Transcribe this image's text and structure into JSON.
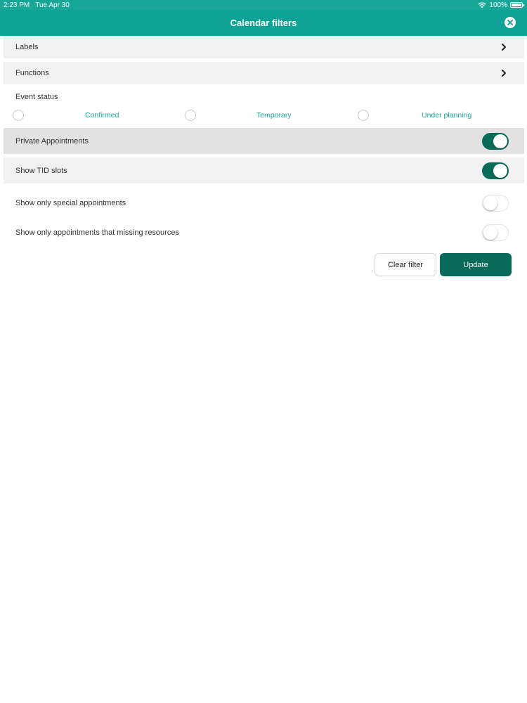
{
  "status_bar": {
    "time": "2:23 PM",
    "date": "Tue Apr 30",
    "battery": "100%"
  },
  "header": {
    "title": "Calendar filters"
  },
  "nav_rows": [
    {
      "label": "Labels"
    },
    {
      "label": "Functions"
    }
  ],
  "event_status": {
    "label": "Event status",
    "options": [
      {
        "label": "Confirmed",
        "selected": false
      },
      {
        "label": "Temporary",
        "selected": false
      },
      {
        "label": "Under planning",
        "selected": false
      }
    ]
  },
  "toggles": [
    {
      "label": "Private Appointments",
      "on": true
    },
    {
      "label": "Show TID slots",
      "on": true
    },
    {
      "label": "Show only special appointments",
      "on": false
    },
    {
      "label": "Show only appointments that missing resources",
      "on": false
    }
  ],
  "buttons": {
    "clear": "Clear filter",
    "update": "Update"
  },
  "colors": {
    "header": "#0fa395",
    "accent_dark": "#086b59",
    "radio_label": "#1aa893"
  }
}
